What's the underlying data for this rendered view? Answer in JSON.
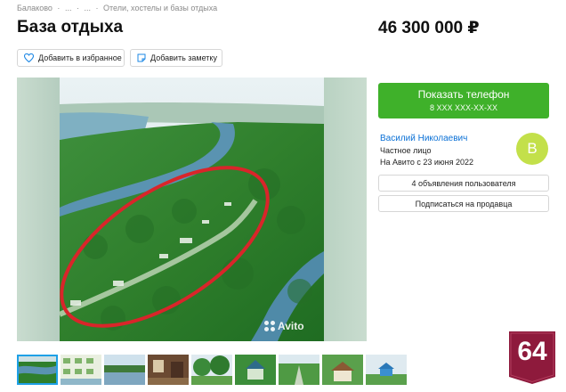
{
  "breadcrumb": [
    "Балаково",
    "·",
    "...",
    "·",
    "...",
    "·",
    "Отели, хостелы и базы отдыха"
  ],
  "title": "База отдыха",
  "price": "46 300 000 ₽",
  "actions": {
    "favorite": "Добавить в избранное",
    "note": "Добавить заметку"
  },
  "photo": {
    "watermark": "Avito"
  },
  "phone": {
    "label": "Показать телефон",
    "masked": "8 XXX XXX-XX-XX"
  },
  "seller": {
    "name": "Василий Николаевич",
    "type": "Частное лицо",
    "since": "На Авито с 23 июня 2022",
    "avatar_letter": "В",
    "avatar_color": "#c3e04a"
  },
  "seller_buttons": {
    "ads": "4 объявления пользователя",
    "subscribe": "Подписаться на продавца"
  },
  "badge": {
    "text": "64",
    "color": "#8e1a3c"
  },
  "colors": {
    "accent_green": "#3fb12a",
    "link_blue": "#0a70d6"
  },
  "thumbnails": [
    {
      "name": "aerial-river"
    },
    {
      "name": "site-plan"
    },
    {
      "name": "river-shore"
    },
    {
      "name": "interior"
    },
    {
      "name": "trees"
    },
    {
      "name": "green-house"
    },
    {
      "name": "path-trees"
    },
    {
      "name": "cabin"
    },
    {
      "name": "blue-house"
    }
  ]
}
